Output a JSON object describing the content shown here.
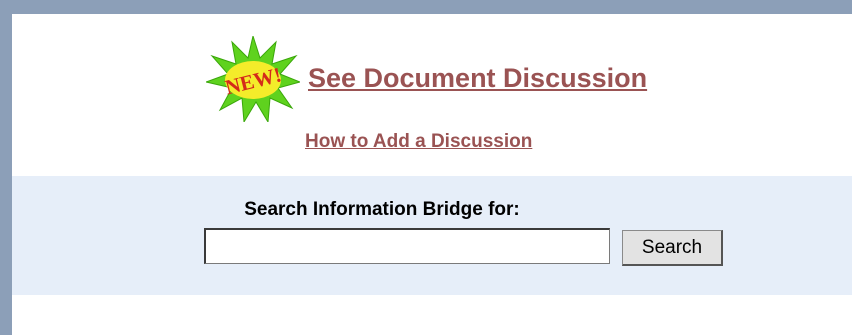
{
  "badge": {
    "icon": "new-starburst-icon",
    "label": "NEW!",
    "colors": {
      "burst": "#5fd21e",
      "core": "#f4ec2a",
      "text": "#d42a1a"
    }
  },
  "links": {
    "discussion": "See Document Discussion",
    "howto": "How to Add a Discussion",
    "color": "#9a5353"
  },
  "search": {
    "title": "Search Information Bridge for:",
    "input_value": "",
    "input_placeholder": "",
    "button_label": "Search"
  },
  "colors": {
    "frame": "#8c9fb8",
    "search_band": "#e6eef9",
    "background": "#ffffff"
  }
}
